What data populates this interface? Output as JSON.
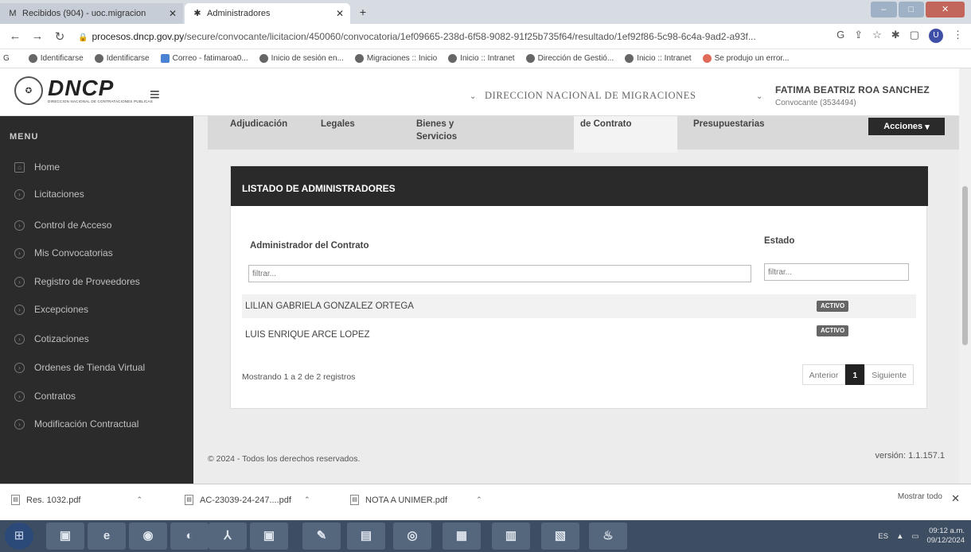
{
  "browser": {
    "tabs": [
      {
        "title": "Recibidos (904) - uoc.migracion",
        "active": false
      },
      {
        "title": "Administradores",
        "active": true
      }
    ],
    "url_host": "procesos.dncp.gov.py",
    "url_path": "/secure/convocante/licitacion/450060/convocatoria/1ef09665-238d-6f58-9082-91f25b735f64/resultado/1ef92f86-5c98-6c4a-9ad2-a93f...",
    "profile_letter": "U",
    "bookmarks": [
      "Identificarse",
      "Identificarse",
      "Correo - fatimaroa0...",
      "Inicio de sesión en...",
      "Migraciones :: Inicio",
      "Inicio :: Intranet",
      "Dirección de Gestió...",
      "Inicio :: Intranet",
      "Se produjo un error..."
    ]
  },
  "header": {
    "logo_text": "DNCP",
    "logo_subtitle": "DIRECCION NACIONAL DE CONTRATACIONES PUBLICAS",
    "institution": "DIRECCION NACIONAL DE MIGRACIONES",
    "user_name": "FATIMA BEATRIZ ROA SANCHEZ",
    "user_role": "Convocante (3534494)"
  },
  "sidebar": {
    "title": "MENU",
    "items": [
      {
        "label": "Home"
      },
      {
        "label": "Licitaciones"
      },
      {
        "label": "Control de Acceso"
      },
      {
        "label": "Mis Convocatorias"
      },
      {
        "label": "Registro de Proveedores"
      },
      {
        "label": "Excepciones"
      },
      {
        "label": "Cotizaciones"
      },
      {
        "label": "Ordenes de Tienda Virtual"
      },
      {
        "label": "Contratos"
      },
      {
        "label": "Modificación Contractual"
      }
    ]
  },
  "tabs": {
    "adjudicacion": "Adjudicación",
    "legales": "Legales",
    "bienes_line1": "Bienes y",
    "bienes_line2": "Servicios",
    "contrato": "de Contrato",
    "presupuestarias": "Presupuestarias",
    "acciones": "Acciones"
  },
  "panel": {
    "title": "LISTADO DE ADMINISTRADORES",
    "col_admin": "Administrador del Contrato",
    "col_estado": "Estado",
    "filter_placeholder": "filtrar...",
    "rows": [
      {
        "name": "LILIAN GABRIELA GONZALEZ ORTEGA",
        "estado": "ACTIVO"
      },
      {
        "name": "LUIS ENRIQUE ARCE LOPEZ",
        "estado": "ACTIVO"
      }
    ],
    "info": "Mostrando 1 a 2 de 2 registros",
    "prev": "Anterior",
    "page": "1",
    "next": "Siguiente"
  },
  "footer": {
    "copyright": "© 2024 - Todos los derechos reservados.",
    "version": "versión: 1.1.157.1"
  },
  "downloads": {
    "files": [
      "Res. 1032.pdf",
      "AC-23039-24-247....pdf",
      "NOTA A UNIMER.pdf"
    ],
    "show_all": "Mostrar todo"
  },
  "taskbar": {
    "lang": "ES",
    "time": "09:12 a.m.",
    "date": "09/12/2024"
  }
}
